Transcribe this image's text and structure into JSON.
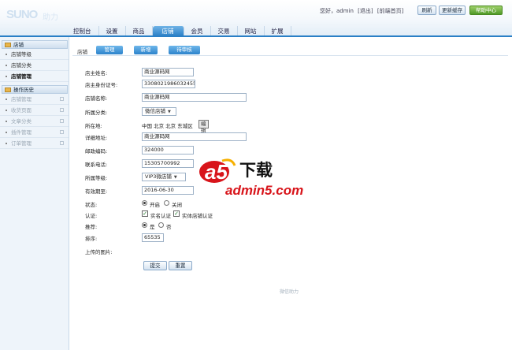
{
  "header": {
    "logo_text": "SUNO",
    "logo_suffix": "助力",
    "welcome": "您好，admin",
    "logout": "[退出]",
    "frontpage": "[前端首页]",
    "buttons": {
      "refresh": "刷新",
      "update_cache": "更新缓存",
      "help": "帮助中心"
    }
  },
  "nav": {
    "tabs": [
      "控制台",
      "设置",
      "商品",
      "店铺",
      "会员",
      "交易",
      "网站",
      "扩展"
    ],
    "active": "店铺"
  },
  "sidebar": {
    "section1": "店铺",
    "items1": [
      "店铺等级",
      "店铺分类",
      "店铺管理"
    ],
    "active_item": "店铺管理",
    "section2": "操作历史",
    "items2": [
      "店铺管理",
      "收货页面",
      "文章分类",
      "插件管理",
      "订单管理"
    ]
  },
  "subbar": {
    "label": "店铺",
    "buttons": [
      "管理",
      "新增",
      "待审核"
    ]
  },
  "form": {
    "owner_name": {
      "label": "店主姓名:",
      "value": "商业源码网"
    },
    "owner_id": {
      "label": "店主身份证号:",
      "value": "330802198603245517"
    },
    "shop_name": {
      "label": "店铺名称:",
      "value": "商业源码网"
    },
    "category": {
      "label": "所属分类:",
      "value": "微信店铺"
    },
    "region": {
      "label": "所在地:",
      "value": "中国  北京  北京  东城区",
      "edit": "编辑"
    },
    "address": {
      "label": "详细地址:",
      "value": "商业源码网"
    },
    "zipcode": {
      "label": "邮政编码:",
      "value": "324000"
    },
    "phone": {
      "label": "联系电话:",
      "value": "15305700992"
    },
    "grade": {
      "label": "所属等级:",
      "value": "VIP3微店铺"
    },
    "expiry": {
      "label": "有效期至:",
      "value": "2016-06-30"
    },
    "status": {
      "label": "状态:",
      "options": [
        "开启",
        "关闭"
      ],
      "selected": "开启"
    },
    "verify": {
      "label": "认证:",
      "options": [
        "实名认证",
        "实体店铺认证"
      ]
    },
    "recommend": {
      "label": "推荐:",
      "options": [
        "是",
        "否"
      ],
      "selected": "是"
    },
    "sort": {
      "label": "排序:",
      "value": "65535"
    },
    "image": {
      "label": "上传的图片:"
    },
    "submit": "提交",
    "reset": "重置"
  },
  "footer": "微信助力",
  "watermark": {
    "brand": "a5",
    "cn": "下载",
    "site": "admin5.com"
  }
}
